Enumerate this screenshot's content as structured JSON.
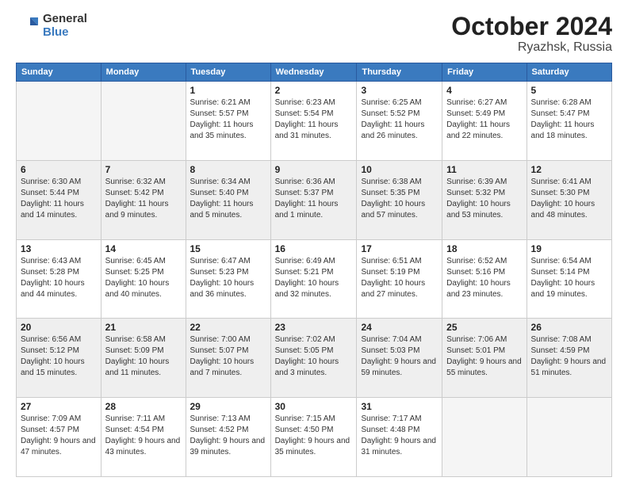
{
  "header": {
    "logo_general": "General",
    "logo_blue": "Blue",
    "title": "October 2024",
    "location": "Ryazhsk, Russia"
  },
  "days_of_week": [
    "Sunday",
    "Monday",
    "Tuesday",
    "Wednesday",
    "Thursday",
    "Friday",
    "Saturday"
  ],
  "weeks": [
    [
      {
        "day": "",
        "empty": true
      },
      {
        "day": "",
        "empty": true
      },
      {
        "day": "1",
        "sunrise": "Sunrise: 6:21 AM",
        "sunset": "Sunset: 5:57 PM",
        "daylight": "Daylight: 11 hours and 35 minutes."
      },
      {
        "day": "2",
        "sunrise": "Sunrise: 6:23 AM",
        "sunset": "Sunset: 5:54 PM",
        "daylight": "Daylight: 11 hours and 31 minutes."
      },
      {
        "day": "3",
        "sunrise": "Sunrise: 6:25 AM",
        "sunset": "Sunset: 5:52 PM",
        "daylight": "Daylight: 11 hours and 26 minutes."
      },
      {
        "day": "4",
        "sunrise": "Sunrise: 6:27 AM",
        "sunset": "Sunset: 5:49 PM",
        "daylight": "Daylight: 11 hours and 22 minutes."
      },
      {
        "day": "5",
        "sunrise": "Sunrise: 6:28 AM",
        "sunset": "Sunset: 5:47 PM",
        "daylight": "Daylight: 11 hours and 18 minutes."
      }
    ],
    [
      {
        "day": "6",
        "sunrise": "Sunrise: 6:30 AM",
        "sunset": "Sunset: 5:44 PM",
        "daylight": "Daylight: 11 hours and 14 minutes."
      },
      {
        "day": "7",
        "sunrise": "Sunrise: 6:32 AM",
        "sunset": "Sunset: 5:42 PM",
        "daylight": "Daylight: 11 hours and 9 minutes."
      },
      {
        "day": "8",
        "sunrise": "Sunrise: 6:34 AM",
        "sunset": "Sunset: 5:40 PM",
        "daylight": "Daylight: 11 hours and 5 minutes."
      },
      {
        "day": "9",
        "sunrise": "Sunrise: 6:36 AM",
        "sunset": "Sunset: 5:37 PM",
        "daylight": "Daylight: 11 hours and 1 minute."
      },
      {
        "day": "10",
        "sunrise": "Sunrise: 6:38 AM",
        "sunset": "Sunset: 5:35 PM",
        "daylight": "Daylight: 10 hours and 57 minutes."
      },
      {
        "day": "11",
        "sunrise": "Sunrise: 6:39 AM",
        "sunset": "Sunset: 5:32 PM",
        "daylight": "Daylight: 10 hours and 53 minutes."
      },
      {
        "day": "12",
        "sunrise": "Sunrise: 6:41 AM",
        "sunset": "Sunset: 5:30 PM",
        "daylight": "Daylight: 10 hours and 48 minutes."
      }
    ],
    [
      {
        "day": "13",
        "sunrise": "Sunrise: 6:43 AM",
        "sunset": "Sunset: 5:28 PM",
        "daylight": "Daylight: 10 hours and 44 minutes."
      },
      {
        "day": "14",
        "sunrise": "Sunrise: 6:45 AM",
        "sunset": "Sunset: 5:25 PM",
        "daylight": "Daylight: 10 hours and 40 minutes."
      },
      {
        "day": "15",
        "sunrise": "Sunrise: 6:47 AM",
        "sunset": "Sunset: 5:23 PM",
        "daylight": "Daylight: 10 hours and 36 minutes."
      },
      {
        "day": "16",
        "sunrise": "Sunrise: 6:49 AM",
        "sunset": "Sunset: 5:21 PM",
        "daylight": "Daylight: 10 hours and 32 minutes."
      },
      {
        "day": "17",
        "sunrise": "Sunrise: 6:51 AM",
        "sunset": "Sunset: 5:19 PM",
        "daylight": "Daylight: 10 hours and 27 minutes."
      },
      {
        "day": "18",
        "sunrise": "Sunrise: 6:52 AM",
        "sunset": "Sunset: 5:16 PM",
        "daylight": "Daylight: 10 hours and 23 minutes."
      },
      {
        "day": "19",
        "sunrise": "Sunrise: 6:54 AM",
        "sunset": "Sunset: 5:14 PM",
        "daylight": "Daylight: 10 hours and 19 minutes."
      }
    ],
    [
      {
        "day": "20",
        "sunrise": "Sunrise: 6:56 AM",
        "sunset": "Sunset: 5:12 PM",
        "daylight": "Daylight: 10 hours and 15 minutes."
      },
      {
        "day": "21",
        "sunrise": "Sunrise: 6:58 AM",
        "sunset": "Sunset: 5:09 PM",
        "daylight": "Daylight: 10 hours and 11 minutes."
      },
      {
        "day": "22",
        "sunrise": "Sunrise: 7:00 AM",
        "sunset": "Sunset: 5:07 PM",
        "daylight": "Daylight: 10 hours and 7 minutes."
      },
      {
        "day": "23",
        "sunrise": "Sunrise: 7:02 AM",
        "sunset": "Sunset: 5:05 PM",
        "daylight": "Daylight: 10 hours and 3 minutes."
      },
      {
        "day": "24",
        "sunrise": "Sunrise: 7:04 AM",
        "sunset": "Sunset: 5:03 PM",
        "daylight": "Daylight: 9 hours and 59 minutes."
      },
      {
        "day": "25",
        "sunrise": "Sunrise: 7:06 AM",
        "sunset": "Sunset: 5:01 PM",
        "daylight": "Daylight: 9 hours and 55 minutes."
      },
      {
        "day": "26",
        "sunrise": "Sunrise: 7:08 AM",
        "sunset": "Sunset: 4:59 PM",
        "daylight": "Daylight: 9 hours and 51 minutes."
      }
    ],
    [
      {
        "day": "27",
        "sunrise": "Sunrise: 7:09 AM",
        "sunset": "Sunset: 4:57 PM",
        "daylight": "Daylight: 9 hours and 47 minutes."
      },
      {
        "day": "28",
        "sunrise": "Sunrise: 7:11 AM",
        "sunset": "Sunset: 4:54 PM",
        "daylight": "Daylight: 9 hours and 43 minutes."
      },
      {
        "day": "29",
        "sunrise": "Sunrise: 7:13 AM",
        "sunset": "Sunset: 4:52 PM",
        "daylight": "Daylight: 9 hours and 39 minutes."
      },
      {
        "day": "30",
        "sunrise": "Sunrise: 7:15 AM",
        "sunset": "Sunset: 4:50 PM",
        "daylight": "Daylight: 9 hours and 35 minutes."
      },
      {
        "day": "31",
        "sunrise": "Sunrise: 7:17 AM",
        "sunset": "Sunset: 4:48 PM",
        "daylight": "Daylight: 9 hours and 31 minutes."
      },
      {
        "day": "",
        "empty": true
      },
      {
        "day": "",
        "empty": true
      }
    ]
  ]
}
